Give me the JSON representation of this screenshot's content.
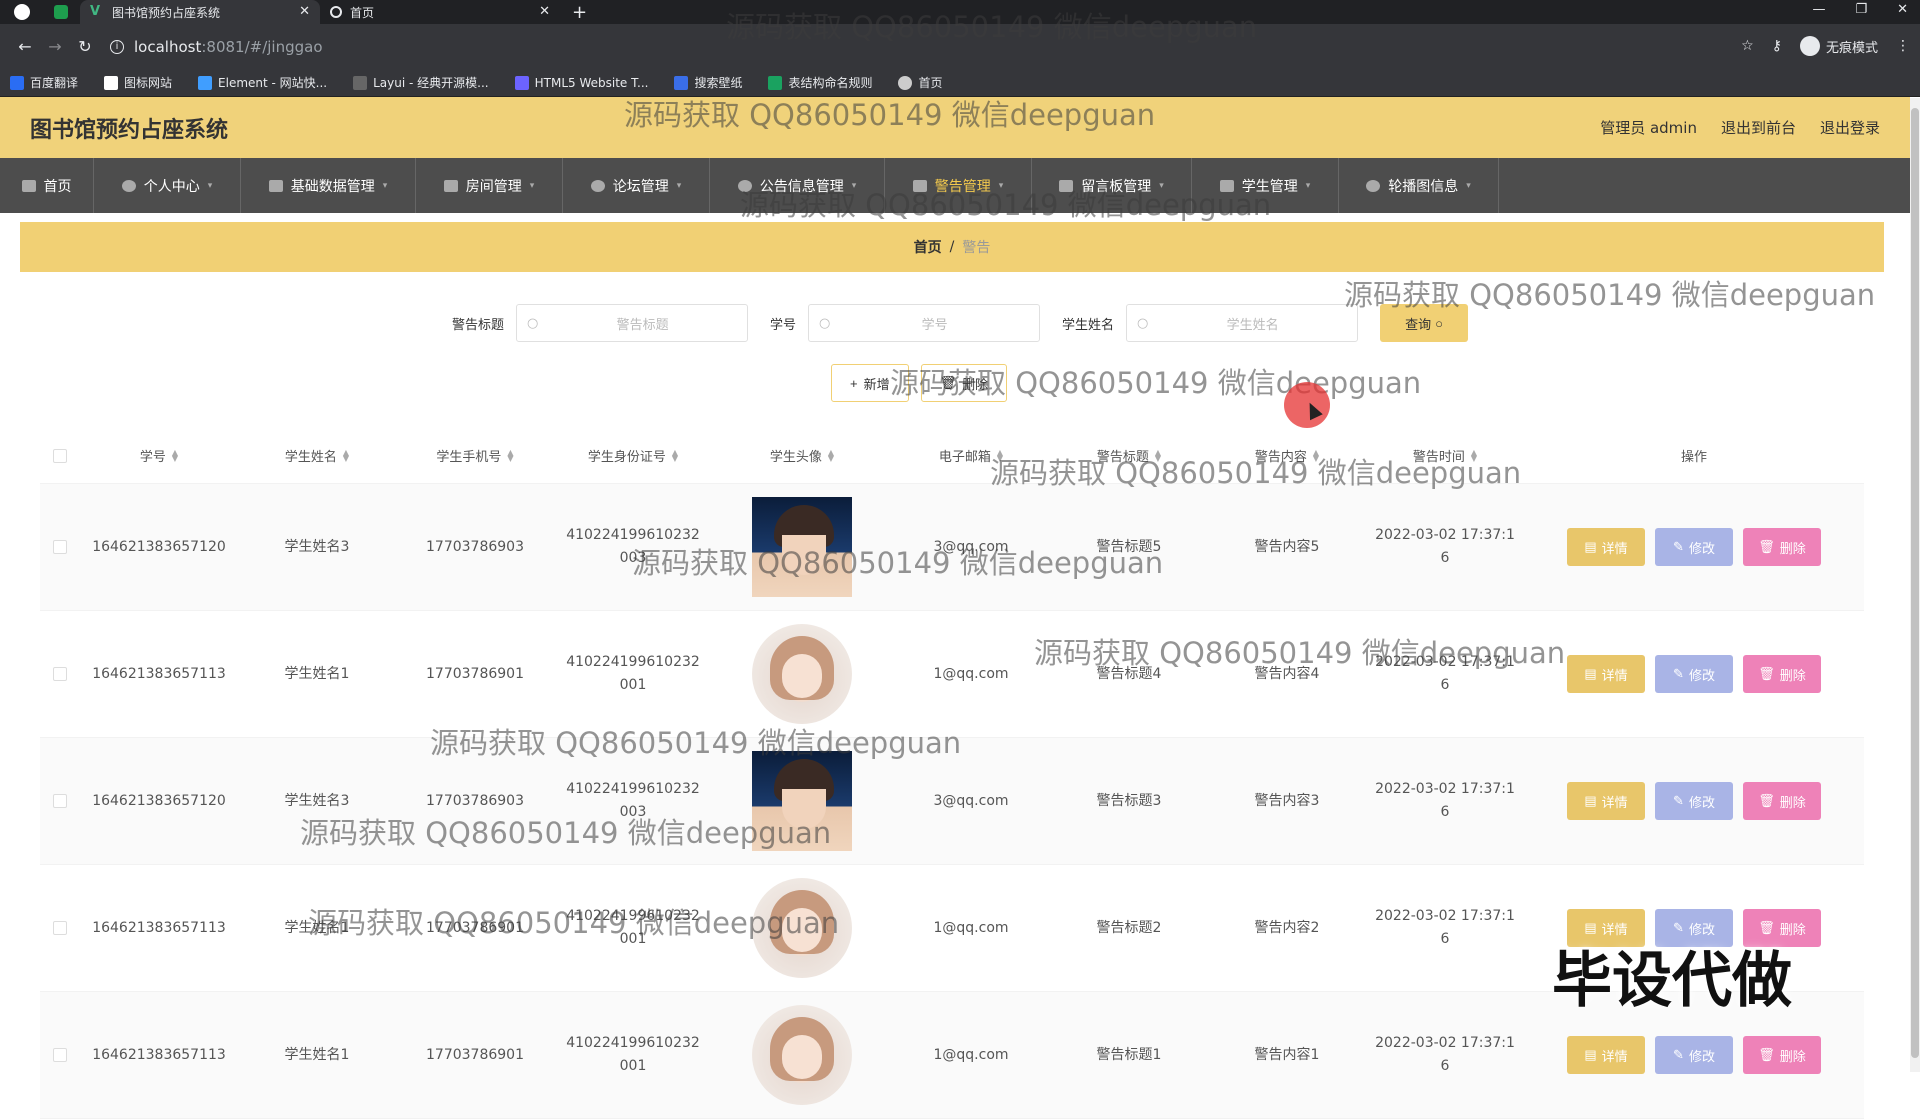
{
  "browser": {
    "tabs": [
      {
        "title": "图书馆预约占座系统",
        "active": true
      },
      {
        "title": "首页",
        "active": false
      }
    ],
    "url_host": "localhost",
    "url_rest": ":8081/#/jinggao",
    "incognito_label": "无痕模式",
    "bookmarks": [
      "百度翻译",
      "图标网站",
      "Element - 网站快...",
      "Layui - 经典开源模...",
      "HTML5 Website T...",
      "搜索壁纸",
      "表结构命名规则",
      "首页"
    ]
  },
  "header": {
    "title": "图书馆预约占座系统",
    "links": [
      "管理员 admin",
      "退出到前台",
      "退出登录"
    ]
  },
  "menu": [
    {
      "label": "首页",
      "active": false
    },
    {
      "label": "个人中心",
      "active": false
    },
    {
      "label": "基础数据管理",
      "active": false
    },
    {
      "label": "房间管理",
      "active": false
    },
    {
      "label": "论坛管理",
      "active": false
    },
    {
      "label": "公告信息管理",
      "active": false
    },
    {
      "label": "警告管理",
      "active": true
    },
    {
      "label": "留言板管理",
      "active": false
    },
    {
      "label": "学生管理",
      "active": false
    },
    {
      "label": "轮播图信息",
      "active": false
    }
  ],
  "breadcrumb": {
    "home": "首页",
    "sep": "/",
    "current": "警告"
  },
  "search": {
    "title_label": "警告标题",
    "title_placeholder": "警告标题",
    "no_label": "学号",
    "no_placeholder": "学号",
    "name_label": "学生姓名",
    "name_placeholder": "学生姓名",
    "query_label": "查询"
  },
  "actions": {
    "add": "新增",
    "delete": "删除"
  },
  "table": {
    "headers": [
      "学号",
      "学生姓名",
      "学生手机号",
      "学生身份证号",
      "学生头像",
      "电子邮箱",
      "警告标题",
      "警告内容",
      "警告时间",
      "操作"
    ],
    "op_labels": {
      "detail": "详情",
      "edit": "修改",
      "delete": "删除"
    },
    "rows": [
      {
        "no": "164621383657120",
        "name": "学生姓名3",
        "phone": "17703786903",
        "idcard": "410224199610232003",
        "avatar": "boy",
        "email": "3@qq.com",
        "title": "警告标题5",
        "content": "警告内容5",
        "time": "2022-03-02 17:37:16"
      },
      {
        "no": "164621383657113",
        "name": "学生姓名1",
        "phone": "17703786901",
        "idcard": "410224199610232001",
        "avatar": "girl",
        "email": "1@qq.com",
        "title": "警告标题4",
        "content": "警告内容4",
        "time": "2022-03-02 17:37:16"
      },
      {
        "no": "164621383657120",
        "name": "学生姓名3",
        "phone": "17703786903",
        "idcard": "410224199610232003",
        "avatar": "boy",
        "email": "3@qq.com",
        "title": "警告标题3",
        "content": "警告内容3",
        "time": "2022-03-02 17:37:16"
      },
      {
        "no": "164621383657113",
        "name": "学生姓名1",
        "phone": "17703786901",
        "idcard": "410224199610232001",
        "avatar": "girl",
        "email": "1@qq.com",
        "title": "警告标题2",
        "content": "警告内容2",
        "time": "2022-03-02 17:37:16"
      },
      {
        "no": "164621383657113",
        "name": "学生姓名1",
        "phone": "17703786901",
        "idcard": "410224199610232001",
        "avatar": "girl",
        "email": "1@qq.com",
        "title": "警告标题1",
        "content": "警告内容1",
        "time": "2022-03-02 17:37:16"
      }
    ]
  },
  "watermark": {
    "text": "源码获取 QQ86050149 微信deepguan",
    "big": "毕设代做"
  },
  "colors": {
    "brand_yellow": "#f0d27a",
    "menu_bg": "#4d4d4d",
    "detail": "#e8c66a",
    "edit": "#a9b4e6",
    "delete": "#ee82b8"
  }
}
